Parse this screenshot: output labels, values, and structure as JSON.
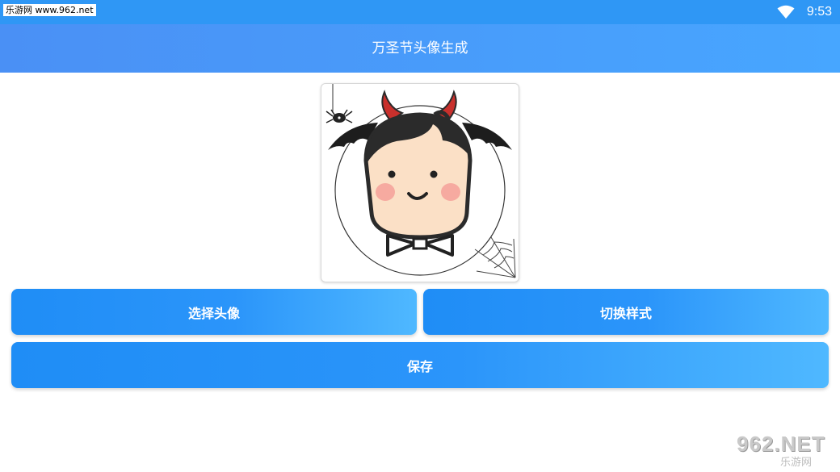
{
  "status_bar": {
    "watermark": "乐游网 www.962.net",
    "time": "9:53",
    "wifi_icon": "wifi-icon"
  },
  "app_bar": {
    "title": "万圣节头像生成"
  },
  "preview": {
    "image_description_icon": "halloween-avatar-image"
  },
  "buttons": {
    "select_avatar": "选择头像",
    "switch_style": "切换样式",
    "save": "保存"
  },
  "bottom_watermark": {
    "logo": "962.NET",
    "text": "乐游网"
  },
  "colors": {
    "status_bar": "#2f97f5",
    "app_bar_start": "#4a90f5",
    "app_bar_end": "#47a6ff",
    "button_start": "#1f8df6",
    "button_end": "#4fb8ff"
  }
}
